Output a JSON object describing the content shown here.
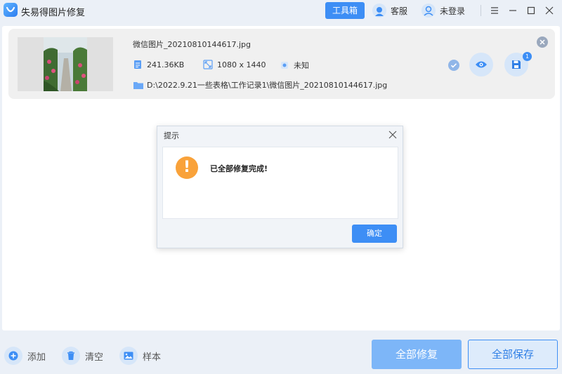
{
  "app": {
    "title": "失易得图片修复",
    "toolbox_label": "工具箱",
    "service_label": "客服",
    "login_label": "未登录"
  },
  "file": {
    "name": "微信图片_20210810144617.jpg",
    "size": "241.36KB",
    "dimensions": "1080 x 1440",
    "format": "未知",
    "path": "D:\\2022.9.21一些表格\\工作记录1\\微信图片_20210810144617.jpg",
    "save_badge": "1"
  },
  "dialog": {
    "title": "提示",
    "message": "已全部修复完成!",
    "icon_glyph": "!",
    "ok_label": "确定"
  },
  "bottom": {
    "add_label": "添加",
    "clear_label": "清空",
    "sample_label": "样本",
    "repair_all_label": "全部修复",
    "save_all_label": "全部保存"
  },
  "colors": {
    "accent": "#3d8ef5",
    "warning": "#f9a23a",
    "background": "#ebf0f7"
  }
}
